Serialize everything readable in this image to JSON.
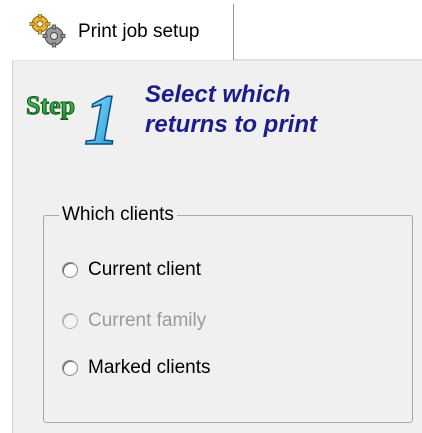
{
  "tab": {
    "label": "Print job setup",
    "icon": "gears-icon"
  },
  "step": {
    "badge_text": "Step",
    "badge_number": "1",
    "title_line1": "Select which",
    "title_line2": "returns to print",
    "title_color": "#1c1c8c"
  },
  "which_clients": {
    "legend": "Which clients",
    "options": [
      {
        "label": "Current client",
        "enabled": true,
        "selected": false
      },
      {
        "label": "Current family",
        "enabled": false,
        "selected": false
      },
      {
        "label": "Marked clients",
        "enabled": true,
        "selected": false
      }
    ]
  }
}
